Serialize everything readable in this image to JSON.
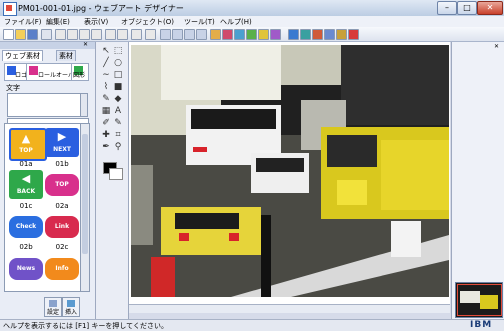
{
  "window": {
    "title": "PM01-001-01.jpg - ウェブアート デザイナー",
    "min_glyph": "–",
    "max_glyph": "□",
    "close_glyph": "✕"
  },
  "menu": [
    "ファイル(F)",
    "編集(E)",
    "表示(V)",
    "オブジェクト(O)",
    "ツール(T)",
    "ヘルプ(H)"
  ],
  "left_panel": {
    "close_glyph": "✕",
    "tabs": [
      "ウェブ素材",
      "素材"
    ],
    "subtabs": [
      "ロゴ",
      "ロールオーバー",
      "図形"
    ],
    "text_label": "文字",
    "gallery": [
      {
        "label": "01a",
        "color": "#f2b21c",
        "text": "TOP",
        "arrow": "▲"
      },
      {
        "label": "01b",
        "color": "#2a5fe0",
        "text": "NEXT",
        "arrow": "▶"
      },
      {
        "label": "01c",
        "color": "#2ea84a",
        "text": "BACK",
        "arrow": "◀"
      },
      {
        "label": "02a",
        "color": "#d8308c",
        "text": "TOP",
        "arrow": ""
      },
      {
        "label": "02b",
        "color": "#2a6ee0",
        "text": "Check",
        "arrow": ""
      },
      {
        "label": "02c",
        "color": "#d82a4e",
        "text": "Link",
        "arrow": ""
      },
      {
        "label": "",
        "color": "#7052c8",
        "text": "News",
        "arrow": ""
      },
      {
        "label": "",
        "color": "#f28a1c",
        "text": "Info",
        "arrow": ""
      }
    ],
    "settings_label": "設定",
    "insert_label": "挿入"
  },
  "status": {
    "text": "ヘルプを表示するには [F1] キーを押してください。",
    "logo": "IBM"
  },
  "colors": {
    "accent": "#2a5fe0",
    "titlebar": "#c8d7ec"
  }
}
